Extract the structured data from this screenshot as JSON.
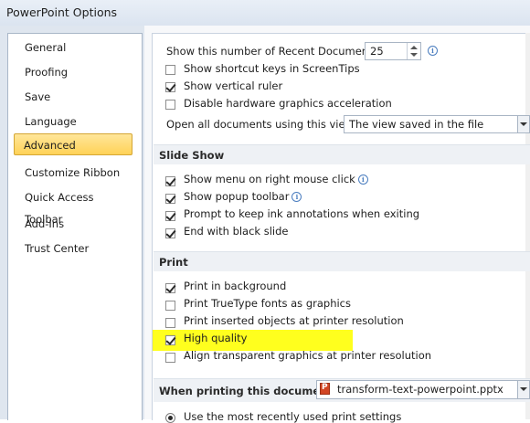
{
  "window": {
    "title": "PowerPoint Options"
  },
  "sidebar": {
    "items": [
      {
        "label": "General"
      },
      {
        "label": "Proofing"
      },
      {
        "label": "Save"
      },
      {
        "label": "Language"
      },
      {
        "label": "Advanced",
        "active": true
      },
      {
        "label": "Customize Ribbon"
      },
      {
        "label": "Quick Access Toolbar"
      },
      {
        "label": "Add-Ins"
      },
      {
        "label": "Trust Center"
      }
    ]
  },
  "display": {
    "recent_docs_label": "Show this number of Recent Documents:",
    "recent_docs_value": "25",
    "shortcut_keys": {
      "label": "Show shortcut keys in ScreenTips",
      "checked": false
    },
    "vertical_ruler": {
      "label": "Show vertical ruler",
      "checked": true
    },
    "disable_hw_accel": {
      "label": "Disable hardware graphics acceleration",
      "checked": false
    },
    "open_view_label": "Open all documents using this view",
    "open_view_value": "The view saved in the file"
  },
  "slide_show": {
    "heading": "Slide Show",
    "items": [
      {
        "label": "Show menu on right mouse click",
        "checked": true,
        "info": true
      },
      {
        "label": "Show popup toolbar",
        "checked": true,
        "info": true
      },
      {
        "label": "Prompt to keep ink annotations when exiting",
        "checked": true,
        "info": false
      },
      {
        "label": "End with black slide",
        "checked": true,
        "info": false
      }
    ]
  },
  "print": {
    "heading": "Print",
    "items": [
      {
        "label": "Print in background",
        "checked": true
      },
      {
        "label": "Print TrueType fonts as graphics",
        "checked": false
      },
      {
        "label": "Print inserted objects at printer resolution",
        "checked": false
      },
      {
        "label": "High quality",
        "checked": true
      },
      {
        "label": "Align transparent graphics at printer resolution",
        "checked": false
      }
    ]
  },
  "printing_doc": {
    "label": "When printing this document:",
    "value": "transform-text-powerpoint.pptx",
    "radio_label": "Use the most recently used print settings"
  },
  "colors": {
    "highlight": "#ffff1e",
    "active_nav": "#ffd257"
  },
  "icons": {
    "info": "info-icon",
    "file": "pptx-file-icon"
  }
}
